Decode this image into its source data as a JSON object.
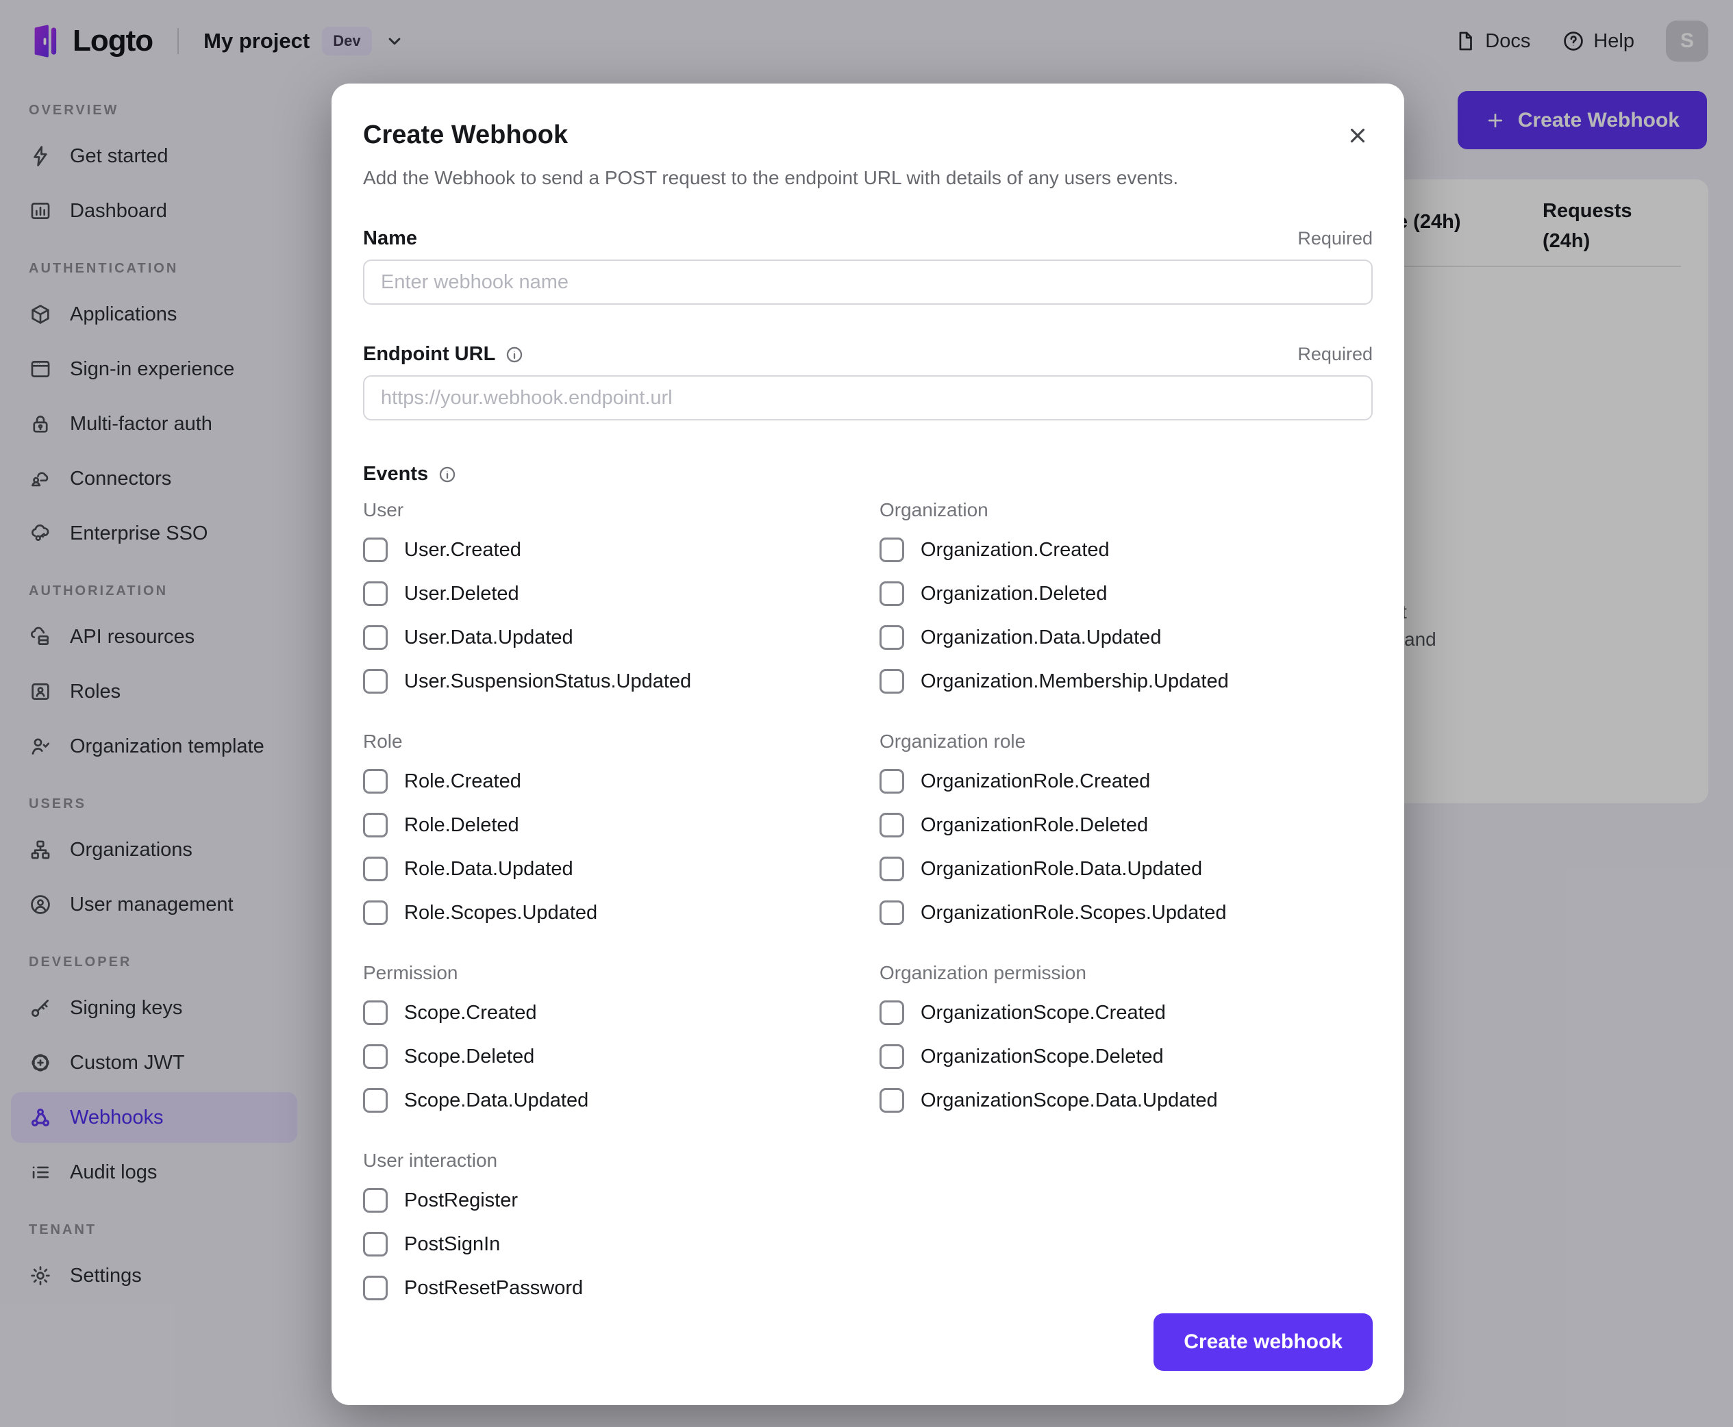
{
  "colors": {
    "accent": "#5d34f2",
    "sidebar_active_bg": "#e3dcfb",
    "sidebar_active_text": "#4e2df0",
    "overlay": "rgba(0,0,0,0.28)",
    "logo_gradient_start": "#ae2feb",
    "logo_gradient_end": "#6a30f2"
  },
  "topbar": {
    "logo_text": "Logto",
    "project_name": "My project",
    "env_badge": "Dev",
    "docs_label": "Docs",
    "help_label": "Help",
    "avatar_initial": "S"
  },
  "sidebar": {
    "sections": [
      {
        "heading": "OVERVIEW",
        "items": [
          {
            "label": "Get started",
            "icon": "lightning-icon"
          },
          {
            "label": "Dashboard",
            "icon": "bar-chart-icon"
          }
        ]
      },
      {
        "heading": "AUTHENTICATION",
        "items": [
          {
            "label": "Applications",
            "icon": "cube-icon"
          },
          {
            "label": "Sign-in experience",
            "icon": "browser-icon"
          },
          {
            "label": "Multi-factor auth",
            "icon": "lock-icon"
          },
          {
            "label": "Connectors",
            "icon": "connector-cloud-icon"
          },
          {
            "label": "Enterprise SSO",
            "icon": "cloud-key-icon"
          }
        ]
      },
      {
        "heading": "AUTHORIZATION",
        "items": [
          {
            "label": "API resources",
            "icon": "cloud-stack-icon"
          },
          {
            "label": "Roles",
            "icon": "id-card-icon"
          },
          {
            "label": "Organization template",
            "icon": "person-check-icon"
          }
        ]
      },
      {
        "heading": "USERS",
        "items": [
          {
            "label": "Organizations",
            "icon": "org-chart-icon"
          },
          {
            "label": "User management",
            "icon": "user-circle-icon"
          }
        ]
      },
      {
        "heading": "DEVELOPER",
        "items": [
          {
            "label": "Signing keys",
            "icon": "key-icon"
          },
          {
            "label": "Custom JWT",
            "icon": "seal-icon"
          },
          {
            "label": "Webhooks",
            "icon": "webhook-icon",
            "active": true
          },
          {
            "label": "Audit logs",
            "icon": "list-icon"
          }
        ]
      },
      {
        "heading": "TENANT",
        "items": [
          {
            "label": "Settings",
            "icon": "gear-icon"
          }
        ]
      }
    ]
  },
  "background": {
    "create_webhook_button": "Create Webhook",
    "table": {
      "success_rate_header_fragment": "e (24h)",
      "requests_header_line1": "Requests",
      "requests_header_line2": "(24h)",
      "empty_state_fragment_line1": "t",
      "empty_state_fragment_line2": "and"
    }
  },
  "modal": {
    "title": "Create Webhook",
    "description": "Add the Webhook to send a POST request to the endpoint URL with details of any users events.",
    "name_field": {
      "label": "Name",
      "required": "Required",
      "placeholder": "Enter webhook name"
    },
    "endpoint_field": {
      "label": "Endpoint URL",
      "required": "Required",
      "placeholder": "https://your.webhook.endpoint.url"
    },
    "events": {
      "label": "Events",
      "groups": [
        {
          "heading": "User",
          "items": [
            "User.Created",
            "User.Deleted",
            "User.Data.Updated",
            "User.SuspensionStatus.Updated"
          ]
        },
        {
          "heading": "Organization",
          "items": [
            "Organization.Created",
            "Organization.Deleted",
            "Organization.Data.Updated",
            "Organization.Membership.Updated"
          ]
        },
        {
          "heading": "Role",
          "items": [
            "Role.Created",
            "Role.Deleted",
            "Role.Data.Updated",
            "Role.Scopes.Updated"
          ]
        },
        {
          "heading": "Organization role",
          "items": [
            "OrganizationRole.Created",
            "OrganizationRole.Deleted",
            "OrganizationRole.Data.Updated",
            "OrganizationRole.Scopes.Updated"
          ]
        },
        {
          "heading": "Permission",
          "items": [
            "Scope.Created",
            "Scope.Deleted",
            "Scope.Data.Updated"
          ]
        },
        {
          "heading": "Organization permission",
          "items": [
            "OrganizationScope.Created",
            "OrganizationScope.Deleted",
            "OrganizationScope.Data.Updated"
          ]
        },
        {
          "heading": "User interaction",
          "items": [
            "PostRegister",
            "PostSignIn",
            "PostResetPassword"
          ]
        }
      ]
    },
    "submit_button": "Create webhook"
  }
}
